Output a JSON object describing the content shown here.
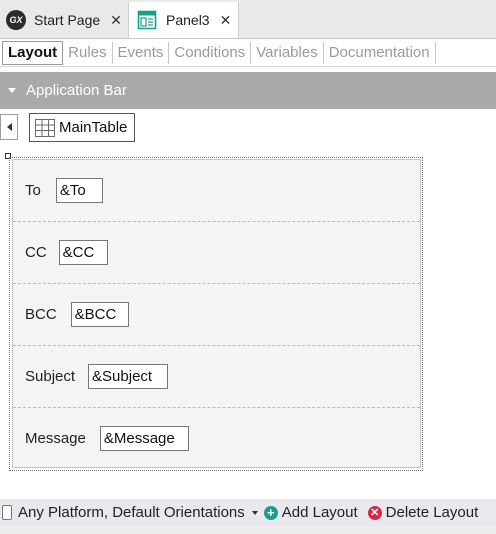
{
  "doc_tabs": [
    {
      "label": "Start Page",
      "close": "✕"
    },
    {
      "label": "Panel3",
      "close": "✕"
    }
  ],
  "gx_logo_text": "GX",
  "section_tabs": [
    "Layout",
    "Rules",
    "Events",
    "Conditions",
    "Variables",
    "Documentation"
  ],
  "app_bar": {
    "label": "Application Bar"
  },
  "main_table": {
    "label": "MainTable"
  },
  "form_rows": [
    {
      "label": "To",
      "variable": "&To"
    },
    {
      "label": "CC",
      "variable": "&CC"
    },
    {
      "label": "BCC",
      "variable": "&BCC"
    },
    {
      "label": "Subject",
      "variable": "&Subject"
    },
    {
      "label": "Message",
      "variable": "&Message"
    }
  ],
  "bottom_bar": {
    "platform": "Any Platform, Default Orientations",
    "add_layout": "Add Layout",
    "delete_layout": "Delete Layout"
  },
  "colors": {
    "app_bar": "#a9a9a9",
    "add_icon": "#1a9e8c",
    "delete_icon": "#d42a4a",
    "panel_icon": "#1a9e8c"
  }
}
